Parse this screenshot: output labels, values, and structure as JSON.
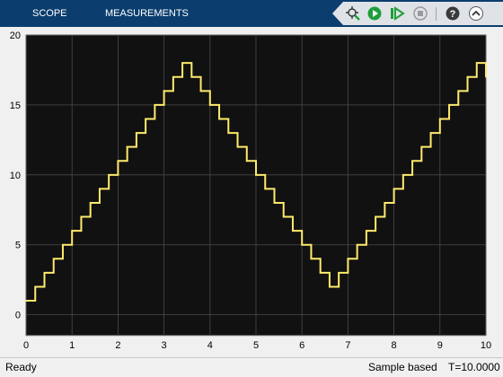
{
  "toolstrip": {
    "tabs": [
      {
        "label": "SCOPE"
      },
      {
        "label": "MEASUREMENTS"
      }
    ],
    "icons": [
      "signal-probe-icon",
      "run-icon",
      "step-forward-icon",
      "stop-icon",
      "help-icon",
      "collapse-icon"
    ],
    "colors": {
      "background": "#0b3e6e",
      "run": "#1e9e3a",
      "stop": "#9a9a9a"
    }
  },
  "status": {
    "left": "Ready",
    "mode": "Sample based",
    "time": "T=10.0000"
  },
  "chart_data": {
    "type": "line",
    "title": "",
    "xlabel": "",
    "ylabel": "",
    "xlim": [
      0,
      10
    ],
    "ylim": [
      -1.5,
      20
    ],
    "xticks": [
      0,
      1,
      2,
      3,
      4,
      5,
      6,
      7,
      8,
      9,
      10
    ],
    "yticks": [
      0,
      5,
      10,
      15,
      20
    ],
    "grid": true,
    "step": true,
    "background": "#111111",
    "line_color": "#ffeb6b",
    "series": [
      {
        "x": [
          0,
          0.2,
          0.4,
          0.6,
          0.8,
          1.0,
          1.2,
          1.4,
          1.6,
          1.8,
          2.0,
          2.2,
          2.4,
          2.6,
          2.8,
          3.0,
          3.2,
          3.4,
          3.6,
          3.8,
          4.0,
          4.2,
          4.4,
          4.6,
          4.8,
          5.0,
          5.2,
          5.4,
          5.6,
          5.8,
          6.0,
          6.2,
          6.4,
          6.6,
          6.8,
          7.0,
          7.2,
          7.4,
          7.6,
          7.8,
          8.0,
          8.2,
          8.4,
          8.6,
          8.8,
          9.0,
          9.2,
          9.4,
          9.6,
          9.8,
          10.0
        ],
        "values": [
          1,
          2,
          3,
          4,
          5,
          6,
          7,
          8,
          9,
          10,
          11,
          12,
          13,
          14,
          15,
          16,
          17,
          18,
          17,
          16,
          15,
          14,
          13,
          12,
          11,
          10,
          9,
          8,
          7,
          6,
          5,
          4,
          3,
          2,
          3,
          4,
          5,
          6,
          7,
          8,
          9,
          10,
          11,
          12,
          13,
          14,
          15,
          16,
          17,
          18,
          17
        ]
      }
    ]
  }
}
